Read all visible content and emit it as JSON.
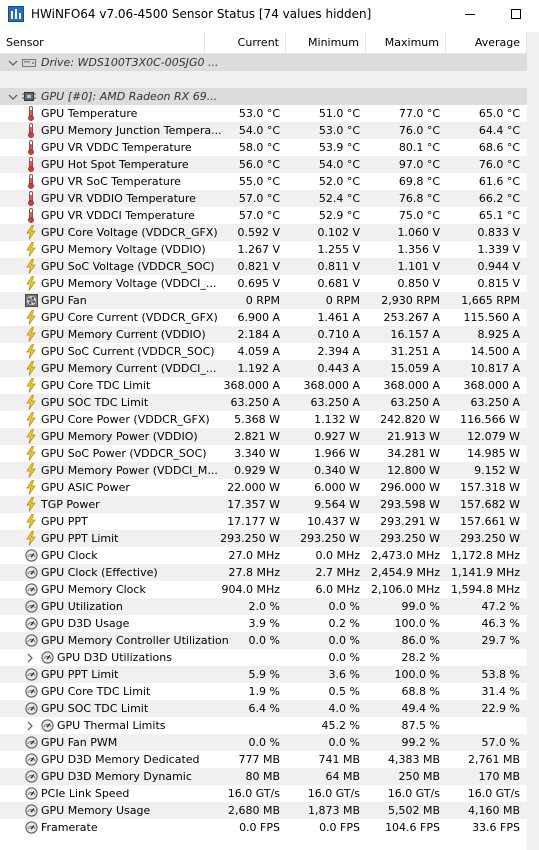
{
  "window": {
    "title": "HWiNFO64 v7.06-4500 Sensor Status [74 values hidden]"
  },
  "columns": {
    "sensor": "Sensor",
    "current": "Current",
    "minimum": "Minimum",
    "maximum": "Maximum",
    "average": "Average"
  },
  "groups": [
    {
      "label": "Drive: WDS100T3X0C-00SJG0 ...",
      "icon": "drive-icon"
    },
    {
      "label": "GPU [#0]: AMD Radeon RX 69...",
      "icon": "gpu-chip-icon"
    }
  ],
  "rows": [
    {
      "name": "GPU Temperature",
      "icon": "thermometer",
      "current": "53.0 °C",
      "min": "51.0 °C",
      "max": "77.0 °C",
      "avg": "65.0 °C"
    },
    {
      "name": "GPU Memory Junction Tempera...",
      "icon": "thermometer",
      "current": "54.0 °C",
      "min": "53.0 °C",
      "max": "76.0 °C",
      "avg": "64.4 °C"
    },
    {
      "name": "GPU VR VDDC Temperature",
      "icon": "thermometer",
      "current": "58.0 °C",
      "min": "53.9 °C",
      "max": "80.1 °C",
      "avg": "68.6 °C"
    },
    {
      "name": "GPU Hot Spot Temperature",
      "icon": "thermometer",
      "current": "56.0 °C",
      "min": "54.0 °C",
      "max": "97.0 °C",
      "avg": "76.0 °C"
    },
    {
      "name": "GPU VR SoC Temperature",
      "icon": "thermometer",
      "current": "55.0 °C",
      "min": "52.0 °C",
      "max": "69.8 °C",
      "avg": "61.6 °C"
    },
    {
      "name": "GPU VR VDDIO Temperature",
      "icon": "thermometer",
      "current": "57.0 °C",
      "min": "52.4 °C",
      "max": "76.8 °C",
      "avg": "66.2 °C"
    },
    {
      "name": "GPU VR VDDCI Temperature",
      "icon": "thermometer",
      "current": "57.0 °C",
      "min": "52.9 °C",
      "max": "75.0 °C",
      "avg": "65.1 °C"
    },
    {
      "name": "GPU Core Voltage (VDDCR_GFX)",
      "icon": "bolt",
      "current": "0.592 V",
      "min": "0.102 V",
      "max": "1.060 V",
      "avg": "0.833 V"
    },
    {
      "name": "GPU Memory Voltage (VDDIO)",
      "icon": "bolt",
      "current": "1.267 V",
      "min": "1.255 V",
      "max": "1.356 V",
      "avg": "1.339 V"
    },
    {
      "name": "GPU SoC Voltage (VDDCR_SOC)",
      "icon": "bolt",
      "current": "0.821 V",
      "min": "0.811 V",
      "max": "1.101 V",
      "avg": "0.944 V"
    },
    {
      "name": "GPU Memory Voltage (VDDCI_...",
      "icon": "bolt",
      "current": "0.695 V",
      "min": "0.681 V",
      "max": "0.850 V",
      "avg": "0.815 V"
    },
    {
      "name": "GPU Fan",
      "icon": "fan",
      "current": "0 RPM",
      "min": "0 RPM",
      "max": "2,930 RPM",
      "avg": "1,665 RPM"
    },
    {
      "name": "GPU Core Current (VDDCR_GFX)",
      "icon": "bolt",
      "current": "6.900 A",
      "min": "1.461 A",
      "max": "253.267 A",
      "avg": "115.560 A"
    },
    {
      "name": "GPU Memory Current (VDDIO)",
      "icon": "bolt",
      "current": "2.184 A",
      "min": "0.710 A",
      "max": "16.157 A",
      "avg": "8.925 A"
    },
    {
      "name": "GPU SoC Current (VDDCR_SOC)",
      "icon": "bolt",
      "current": "4.059 A",
      "min": "2.394 A",
      "max": "31.251 A",
      "avg": "14.500 A"
    },
    {
      "name": "GPU Memory Current (VDDCI_...",
      "icon": "bolt",
      "current": "1.192 A",
      "min": "0.443 A",
      "max": "15.059 A",
      "avg": "10.817 A"
    },
    {
      "name": "GPU Core TDC Limit",
      "icon": "bolt",
      "current": "368.000 A",
      "min": "368.000 A",
      "max": "368.000 A",
      "avg": "368.000 A"
    },
    {
      "name": "GPU SOC TDC Limit",
      "icon": "bolt",
      "current": "63.250 A",
      "min": "63.250 A",
      "max": "63.250 A",
      "avg": "63.250 A"
    },
    {
      "name": "GPU Core Power (VDDCR_GFX)",
      "icon": "bolt",
      "current": "5.368 W",
      "min": "1.132 W",
      "max": "242.820 W",
      "avg": "116.566 W"
    },
    {
      "name": "GPU Memory Power (VDDIO)",
      "icon": "bolt",
      "current": "2.821 W",
      "min": "0.927 W",
      "max": "21.913 W",
      "avg": "12.079 W"
    },
    {
      "name": "GPU SoC Power (VDDCR_SOC)",
      "icon": "bolt",
      "current": "3.340 W",
      "min": "1.966 W",
      "max": "34.281 W",
      "avg": "14.985 W"
    },
    {
      "name": "GPU Memory Power (VDDCI_M...",
      "icon": "bolt",
      "current": "0.929 W",
      "min": "0.340 W",
      "max": "12.800 W",
      "avg": "9.152 W"
    },
    {
      "name": "GPU ASIC Power",
      "icon": "bolt",
      "current": "22.000 W",
      "min": "6.000 W",
      "max": "296.000 W",
      "avg": "157.318 W"
    },
    {
      "name": "TGP Power",
      "icon": "bolt",
      "current": "17.357 W",
      "min": "9.564 W",
      "max": "293.598 W",
      "avg": "157.682 W"
    },
    {
      "name": "GPU PPT",
      "icon": "bolt",
      "current": "17.177 W",
      "min": "10.437 W",
      "max": "293.291 W",
      "avg": "157.661 W"
    },
    {
      "name": "GPU PPT Limit",
      "icon": "bolt",
      "current": "293.250 W",
      "min": "293.250 W",
      "max": "293.250 W",
      "avg": "293.250 W"
    },
    {
      "name": "GPU Clock",
      "icon": "gauge",
      "current": "27.0 MHz",
      "min": "0.0 MHz",
      "max": "2,473.0 MHz",
      "avg": "1,172.8 MHz"
    },
    {
      "name": "GPU Clock (Effective)",
      "icon": "gauge",
      "current": "27.8 MHz",
      "min": "2.7 MHz",
      "max": "2,454.9 MHz",
      "avg": "1,141.9 MHz"
    },
    {
      "name": "GPU Memory Clock",
      "icon": "gauge",
      "current": "904.0 MHz",
      "min": "6.0 MHz",
      "max": "2,106.0 MHz",
      "avg": "1,594.8 MHz"
    },
    {
      "name": "GPU Utilization",
      "icon": "gauge",
      "current": "2.0 %",
      "min": "0.0 %",
      "max": "99.0 %",
      "avg": "47.2 %"
    },
    {
      "name": "GPU D3D Usage",
      "icon": "gauge",
      "current": "3.9 %",
      "min": "0.2 %",
      "max": "100.0 %",
      "avg": "46.3 %"
    },
    {
      "name": "GPU Memory Controller Utilization",
      "icon": "gauge",
      "current": "0.0 %",
      "min": "0.0 %",
      "max": "86.0 %",
      "avg": "29.7 %"
    },
    {
      "name": "GPU D3D Utilizations",
      "icon": "gauge",
      "sub": true,
      "current": "",
      "min": "0.0 %",
      "max": "28.2 %",
      "avg": ""
    },
    {
      "name": "GPU PPT Limit",
      "icon": "gauge",
      "current": "5.9 %",
      "min": "3.6 %",
      "max": "100.0 %",
      "avg": "53.8 %"
    },
    {
      "name": "GPU Core TDC Limit",
      "icon": "gauge",
      "current": "1.9 %",
      "min": "0.5 %",
      "max": "68.8 %",
      "avg": "31.4 %"
    },
    {
      "name": "GPU SOC TDC Limit",
      "icon": "gauge",
      "current": "6.4 %",
      "min": "4.0 %",
      "max": "49.4 %",
      "avg": "22.9 %"
    },
    {
      "name": "GPU Thermal Limits",
      "icon": "gauge",
      "sub": true,
      "current": "",
      "min": "45.2 %",
      "max": "87.5 %",
      "avg": ""
    },
    {
      "name": "GPU Fan PWM",
      "icon": "gauge",
      "current": "0.0 %",
      "min": "0.0 %",
      "max": "99.2 %",
      "avg": "57.0 %"
    },
    {
      "name": "GPU D3D Memory Dedicated",
      "icon": "gauge",
      "current": "777 MB",
      "min": "741 MB",
      "max": "4,383 MB",
      "avg": "2,761 MB"
    },
    {
      "name": "GPU D3D Memory Dynamic",
      "icon": "gauge",
      "current": "80 MB",
      "min": "64 MB",
      "max": "250 MB",
      "avg": "170 MB"
    },
    {
      "name": "PCIe Link Speed",
      "icon": "gauge",
      "current": "16.0 GT/s",
      "min": "16.0 GT/s",
      "max": "16.0 GT/s",
      "avg": "16.0 GT/s"
    },
    {
      "name": "GPU Memory Usage",
      "icon": "gauge",
      "current": "2,680 MB",
      "min": "1,873 MB",
      "max": "5,502 MB",
      "avg": "4,160 MB"
    },
    {
      "name": "Framerate",
      "icon": "gauge",
      "current": "0.0 FPS",
      "min": "0.0 FPS",
      "max": "104.6 FPS",
      "avg": "33.6 FPS"
    }
  ]
}
